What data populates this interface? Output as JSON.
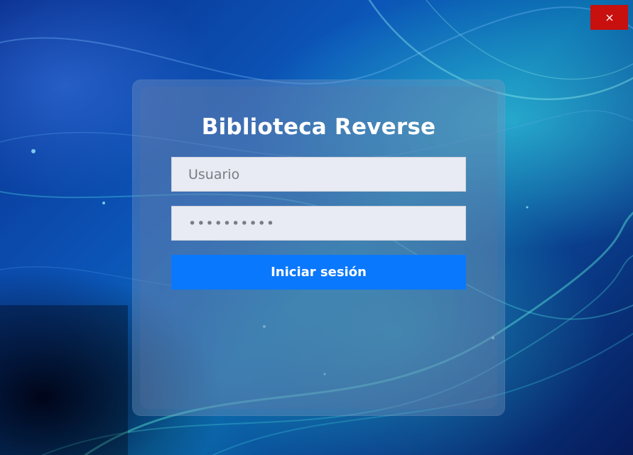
{
  "window": {
    "close_icon": "close-icon",
    "close_button_color": "#c8100e"
  },
  "login": {
    "title": "Biblioteca Reverse",
    "username_placeholder": "Usuario",
    "password_value": "••••••••••",
    "submit_label": "Iniciar sesión",
    "submit_color": "#0a78fc"
  }
}
